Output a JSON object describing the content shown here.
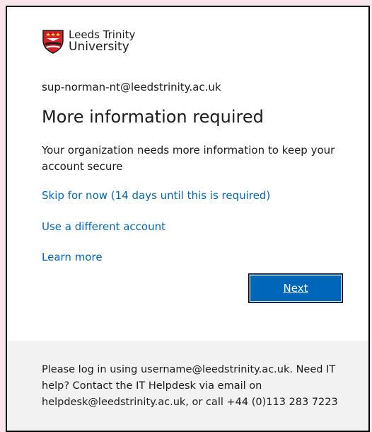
{
  "brand": {
    "line1": "Leeds Trinity",
    "line2": "University",
    "crest_color": "#d4212a"
  },
  "account_email": "sup-norman-nt@leedstrinity.ac.uk",
  "title": "More information required",
  "description": "Your organization needs more information to keep your account secure",
  "links": {
    "skip": "Skip for now (14 days until this is required)",
    "different_account": "Use a different account",
    "learn_more": "Learn more"
  },
  "next_button_label": "Next",
  "footer_text": "Please log in using username@leedstrinity.ac.uk. Need IT help? Contact the IT Helpdesk via email on helpdesk@leedstrinity.ac.uk, or call +44 (0)113 283 7223",
  "colors": {
    "accent": "#0067b8",
    "page_background": "#f8e6ea",
    "footer_background": "#f2f2f2"
  }
}
